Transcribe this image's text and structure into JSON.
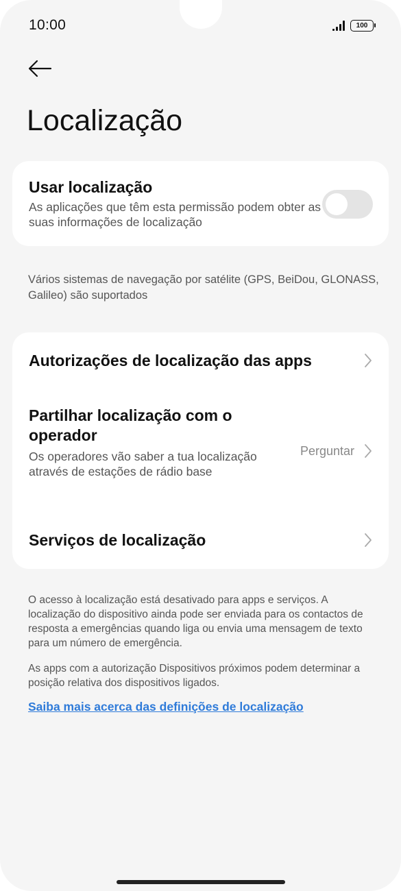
{
  "status_bar": {
    "time": "10:00",
    "battery": "100"
  },
  "header": {
    "title": "Localização"
  },
  "use_location": {
    "title": "Usar localização",
    "description": "As aplicações que têm esta permissão podem obter as suas informações de localização",
    "enabled": false
  },
  "gnss_note": "Vários sistemas de navegação por satélite (GPS, BeiDou, GLONASS, Galileo) são suportados",
  "settings_list": {
    "app_permissions": {
      "title": "Autorizações de localização das apps"
    },
    "share_with_operator": {
      "title": "Partilhar localização com o operador",
      "description": "Os operadores vão saber a tua localização através de estações de rádio base",
      "value": "Perguntar"
    },
    "location_services": {
      "title": "Serviços de localização"
    }
  },
  "footer": {
    "paragraph1": "O acesso à localização está desativado para apps e serviços. A localização do dispositivo ainda pode ser enviada para os contactos de resposta a emergências quando liga ou envia uma mensagem de texto para um número de emergência.",
    "paragraph2": "As apps com a autorização Dispositivos próximos podem determinar a posição relativa dos dispositivos ligados.",
    "learn_more_link": "Saiba mais acerca das definições de localização"
  },
  "colors": {
    "background": "#f5f5f5",
    "card": "#ffffff",
    "link": "#2f7bd9",
    "toggle_off": "#e4e4e4"
  },
  "icons": [
    "signal-icon",
    "battery-icon",
    "back-arrow-icon",
    "chevron-right-icon"
  ]
}
